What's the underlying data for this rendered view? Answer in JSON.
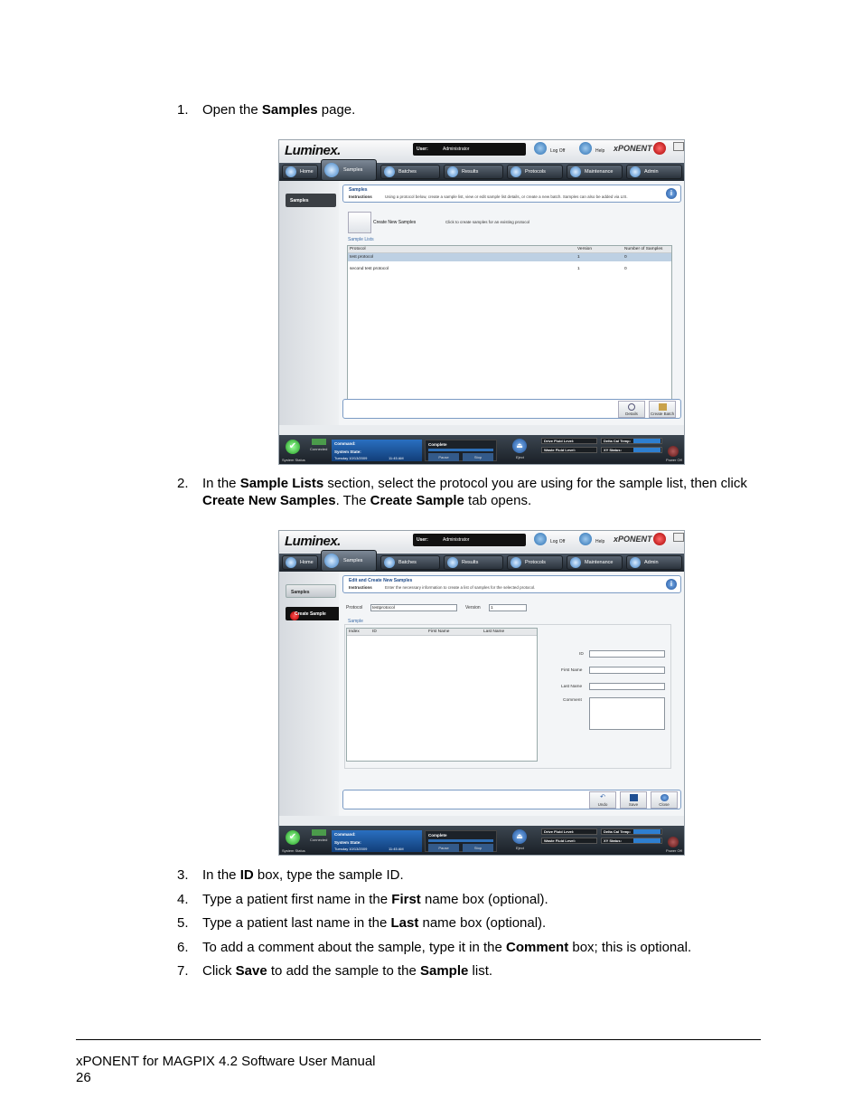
{
  "steps": [
    {
      "num": "1.",
      "parts": [
        "Open the ",
        "Samples",
        " page."
      ]
    },
    {
      "num": "2.",
      "parts": [
        "In the ",
        "Sample Lists",
        " section, select the protocol you are using for the sample list, then click ",
        "Create New Samples",
        ". The ",
        "Create Sample",
        " tab opens."
      ]
    },
    {
      "num": "3.",
      "parts": [
        "In the ",
        "ID",
        " box, type the sample ID."
      ]
    },
    {
      "num": "4.",
      "parts": [
        "Type a patient first name in the ",
        "First",
        " name box (optional)."
      ]
    },
    {
      "num": "5.",
      "parts": [
        "Type a patient last name in the ",
        "Last",
        " name box (optional)."
      ]
    },
    {
      "num": "6.",
      "parts": [
        "To add a comment about the sample, type it in the ",
        "Comment",
        " box; this is optional."
      ]
    },
    {
      "num": "7.",
      "parts": [
        "Click ",
        "Save",
        " to add the sample to the ",
        "Sample",
        " list."
      ]
    }
  ],
  "app": {
    "logo": "Luminex.",
    "user_label": "User:",
    "user_value": "Administrator",
    "logoff": "Log Off",
    "help": "Help",
    "brand": "xPONENT",
    "nav": [
      "Home",
      "Samples",
      "Batches",
      "Results",
      "Protocols",
      "Maintenance",
      "Admin"
    ],
    "status": {
      "system_status": "System Status",
      "connected": "Connected",
      "command": "Command:",
      "system_state": "System State:",
      "datetime": "Tuesday 10/13/2009",
      "time": "11:45 AM",
      "complete": "Complete",
      "pause": "Pause",
      "stop": "Stop",
      "eject": "Eject",
      "sheath": "Drive Fluid Level:",
      "waste": "Waste Fluid Level:",
      "delta": "Delta Cal Temp:",
      "xy": "XY Status:",
      "power": "Power Off"
    }
  },
  "shot1": {
    "side_tab": "Samples",
    "header_title": "Samples",
    "instructions_label": "Instructions",
    "instructions_text": "Using a protocol below, create a sample list, view or edit sample list details, or create a new batch. Samples can also be added via LIS.",
    "create_new": "Create New Samples",
    "create_new_desc": "Click to create samples for an existing protocol",
    "sample_lists": "Sample Lists",
    "columns": [
      "Protocol",
      "Version",
      "Number of Samples"
    ],
    "rows": [
      [
        "test protocol",
        "1",
        "0"
      ],
      [
        "second test protocol",
        "1",
        "0"
      ]
    ],
    "buttons": [
      "Details",
      "Create Batch"
    ]
  },
  "shot2": {
    "side_tabs": [
      "Samples",
      "Create Sample"
    ],
    "header_title": "Edit and Create New Samples",
    "instructions_label": "Instructions",
    "instructions_text": "Enter the necessary information to create a list of samples for the selected protocol.",
    "protocol_label": "Protocol",
    "protocol_value": "testprotocol",
    "version_label": "Version",
    "version_value": "1",
    "sample_group": "Sample",
    "columns": [
      "Index",
      "ID",
      "First Name",
      "Last Name"
    ],
    "id_label": "ID",
    "first_label": "First Name",
    "last_label": "Last Name",
    "comment_label": "Comment",
    "buttons": [
      "Undo",
      "Save",
      "Close"
    ]
  },
  "footer": {
    "title": "xPONENT for MAGPIX 4.2 Software User Manual",
    "page": "26"
  }
}
